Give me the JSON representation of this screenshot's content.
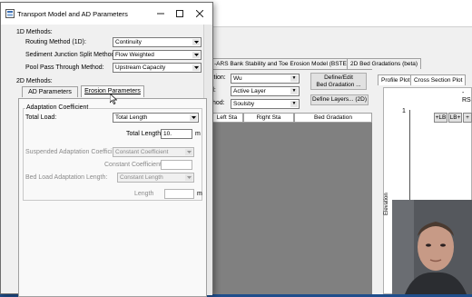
{
  "background_window": {
    "tabs": [
      "-ARS Bank Stability and Toe Erosion Model (BSTEM)",
      "2D Bed Gradations (beta)"
    ],
    "fields": [
      {
        "label": "ction:",
        "value": "Wu"
      },
      {
        "label": "d:",
        "value": "Active Layer"
      },
      {
        "label": "thod:",
        "value": "Soulsby"
      }
    ],
    "buttons": {
      "define_edit": "Define/Edit",
      "bed_gradation": "Bed Gradation ...",
      "define_layers": "Define Layers... (2D)"
    },
    "grid_headers": [
      "Left Sta",
      "Right Sta",
      "Bed Gradation"
    ],
    "plot_tabs": [
      "Profile Plot",
      "Cross Section Plot"
    ],
    "plot_buttons": [
      "+LB",
      "LB+",
      "+"
    ],
    "plot_axis_label": "Elevation",
    "plot_tick_1": "1",
    "plot_corner_label": "RS",
    "plot_dash": "-"
  },
  "dialog": {
    "title": "Transport Model and AD Parameters",
    "section_1d": "1D Methods:",
    "routing_label": "Routing Method (1D):",
    "routing_value": "Continuity",
    "sediment_label": "Sediment Junction Split Method:",
    "sediment_value": "Flow Weighted",
    "pool_label": "Pool Pass Through Method:",
    "pool_value": "Upstream Capacity",
    "section_2d": "2D Methods:",
    "tabs": [
      "AD Parameters",
      "Erosion Parameters"
    ],
    "active_tab": "Erosion Parameters",
    "group_title": "Adaptation Coefficient",
    "total_load_label": "Total Load:",
    "total_load_value": "Total Length",
    "total_length_label": "Total Length:",
    "total_length_value": "10.",
    "total_length_unit": "m",
    "suspended_label": "Suspended Adaptation Coefficient:",
    "suspended_value": "Constant Coefficient",
    "constant_coeff_label": "Constant Coefficient",
    "bedload_label": "Bed Load Adaptation Length:",
    "bedload_value": "Constant Length",
    "length_label": "Length",
    "length_unit": "m"
  }
}
